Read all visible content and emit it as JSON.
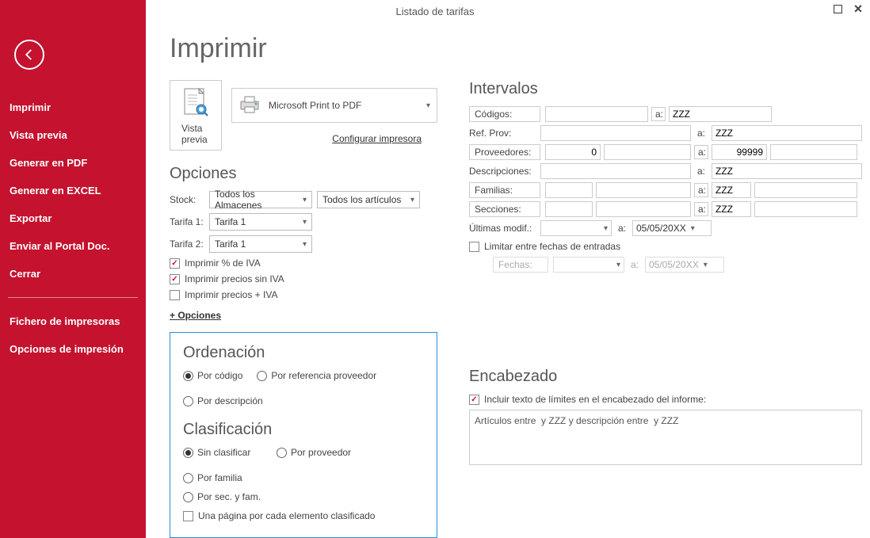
{
  "titlebar": {
    "title": "Listado de tarifas"
  },
  "sidebar": {
    "items": [
      "Imprimir",
      "Vista previa",
      "Generar en PDF",
      "Generar en EXCEL",
      "Exportar",
      "Enviar al Portal Doc.",
      "Cerrar"
    ],
    "items2": [
      "Fichero de impresoras",
      "Opciones de impresión"
    ]
  },
  "page": {
    "title": "Imprimir"
  },
  "print": {
    "vista_label": "Vista previa",
    "printer_name": "Microsoft Print to PDF",
    "config_link": "Configurar impresora"
  },
  "opciones": {
    "heading": "Opciones",
    "stock_label": "Stock:",
    "stock_sel1": "Todos los Almacenes",
    "stock_sel2": "Todos los artículos",
    "tarifa1_label": "Tarifa 1:",
    "tarifa1_value": "Tarifa 1",
    "tarifa2_label": "Tarifa 2:",
    "tarifa2_value": "Tarifa 1",
    "chk_iva": "Imprimir % de IVA",
    "chk_sin_iva": "Imprimir precios sin IVA",
    "chk_con_iva": "Imprimir precios + IVA",
    "more": "+ Opciones"
  },
  "ordenacion": {
    "heading": "Ordenación",
    "r1": "Por código",
    "r2": "Por referencia proveedor",
    "r3": "Por descripción"
  },
  "clasificacion": {
    "heading": "Clasificación",
    "r1": "Sin clasificar",
    "r2": "Por proveedor",
    "r3": "Por familia",
    "r4": "Por sec. y fam.",
    "chk": "Una página por cada elemento clasificado"
  },
  "intervalos": {
    "heading": "Intervalos",
    "codigos": "Códigos:",
    "codigos_to": "ZZZ",
    "refprov": "Ref. Prov:",
    "refprov_to": "ZZZ",
    "proveedores": "Proveedores:",
    "proveedores_from": "0",
    "proveedores_to": "99999",
    "descripciones": "Descripciones:",
    "descripciones_to": "ZZZ",
    "familias": "Familias:",
    "familias_to": "ZZZ",
    "secciones": "Secciones:",
    "secciones_to": "ZZZ",
    "ultimas": "Últimas modif.:",
    "ultimas_to": "05/05/20XX",
    "a": "a:",
    "limitar": "Limitar entre fechas de entradas",
    "fechas": "Fechas:",
    "fechas_to": "05/05/20XX"
  },
  "encabezado": {
    "heading": "Encabezado",
    "chk": "Incluir texto de límites en el encabezado del informe:",
    "text": "Artículos entre  y ZZZ y descripción entre  y ZZZ"
  }
}
